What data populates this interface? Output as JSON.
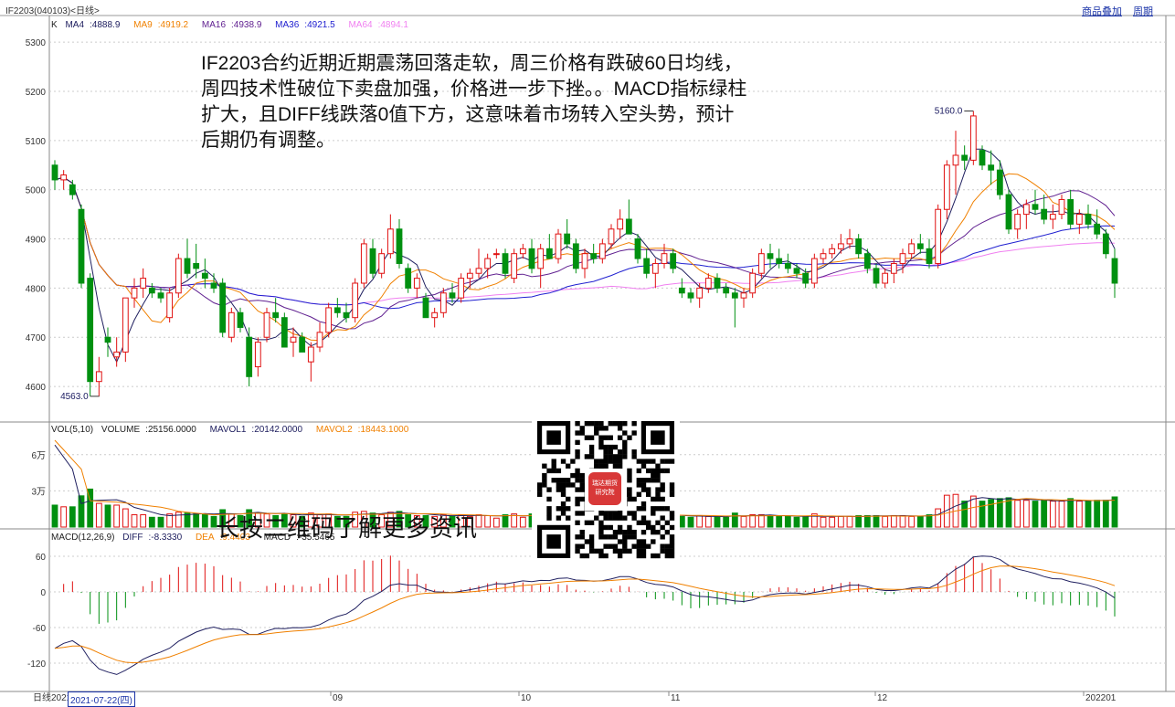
{
  "window": {
    "title": "IF2203(040103)<日线>",
    "links": [
      "商品叠加",
      "周期"
    ],
    "period_label": "日线",
    "cursor_date": "2021-07-22(四)"
  },
  "annotation": {
    "text": "IF2203合约近期近期震荡回落走软，周三价格有跌破60日均线，周四技术性破位下卖盘加强，价格进一步下挫。。MACD指标绿柱扩大，且DIFF线跌落0值下方，这意味着市场转入空头势，预计后期仍有调整。"
  },
  "qr": {
    "caption": "长按二维码了解更多资讯",
    "center_label": "瑞达期货研究院"
  },
  "colors": {
    "up": "#e01010",
    "down": "#009010",
    "ma4": "#202060",
    "ma9": "#f08000",
    "ma16": "#602090",
    "ma36": "#2020d0",
    "ma64": "#f080f0",
    "dea": "#f08000",
    "diff": "#202060"
  },
  "chart_data": [
    {
      "type": "candlestick",
      "title": "K",
      "legend": [
        {
          "name": "MA4",
          "value": "4888.9"
        },
        {
          "name": "MA9",
          "value": "4919.2"
        },
        {
          "name": "MA16",
          "value": "4938.9"
        },
        {
          "name": "MA36",
          "value": "4921.5"
        },
        {
          "name": "MA64",
          "value": "4894.1"
        }
      ],
      "y_ticks": [
        4600,
        4700,
        4800,
        4900,
        5000,
        5100,
        5200,
        5300
      ],
      "ylim": [
        4550,
        5330
      ],
      "x_labels": [
        "2021",
        "09",
        "10",
        "11",
        "12",
        "202201"
      ],
      "high_label": "5160.0",
      "low_label": "4563.0",
      "candles": [
        [
          5050,
          5060,
          5000,
          5020
        ],
        [
          5020,
          5040,
          5000,
          5030
        ],
        [
          5010,
          5020,
          4980,
          4990
        ],
        [
          4960,
          4970,
          4800,
          4810
        ],
        [
          4820,
          4830,
          4580,
          4610
        ],
        [
          4610,
          4660,
          4580,
          4630
        ],
        [
          4700,
          4720,
          4660,
          4690
        ],
        [
          4660,
          4700,
          4640,
          4670
        ],
        [
          4670,
          4780,
          4650,
          4780
        ],
        [
          4780,
          4820,
          4760,
          4800
        ],
        [
          4800,
          4840,
          4780,
          4820
        ],
        [
          4800,
          4810,
          4780,
          4790
        ],
        [
          4790,
          4800,
          4770,
          4780
        ],
        [
          4740,
          4800,
          4730,
          4790
        ],
        [
          4790,
          4870,
          4780,
          4860
        ],
        [
          4860,
          4900,
          4820,
          4830
        ],
        [
          4850,
          4890,
          4820,
          4840
        ],
        [
          4830,
          4860,
          4800,
          4820
        ],
        [
          4810,
          4830,
          4790,
          4800
        ],
        [
          4810,
          4820,
          4700,
          4710
        ],
        [
          4700,
          4760,
          4690,
          4750
        ],
        [
          4750,
          4760,
          4710,
          4720
        ],
        [
          4700,
          4720,
          4600,
          4620
        ],
        [
          4640,
          4700,
          4620,
          4690
        ],
        [
          4700,
          4760,
          4690,
          4750
        ],
        [
          4750,
          4780,
          4730,
          4740
        ],
        [
          4740,
          4750,
          4680,
          4680
        ],
        [
          4690,
          4720,
          4660,
          4700
        ],
        [
          4700,
          4710,
          4670,
          4670
        ],
        [
          4650,
          4690,
          4610,
          4680
        ],
        [
          4680,
          4730,
          4670,
          4710
        ],
        [
          4710,
          4770,
          4700,
          4760
        ],
        [
          4760,
          4780,
          4740,
          4750
        ],
        [
          4750,
          4770,
          4730,
          4740
        ],
        [
          4740,
          4820,
          4730,
          4810
        ],
        [
          4810,
          4900,
          4800,
          4890
        ],
        [
          4880,
          4900,
          4820,
          4830
        ],
        [
          4830,
          4880,
          4820,
          4870
        ],
        [
          4870,
          4950,
          4860,
          4920
        ],
        [
          4920,
          4940,
          4840,
          4850
        ],
        [
          4840,
          4850,
          4790,
          4800
        ],
        [
          4800,
          4830,
          4780,
          4820
        ],
        [
          4780,
          4790,
          4740,
          4740
        ],
        [
          4740,
          4760,
          4720,
          4750
        ],
        [
          4750,
          4800,
          4740,
          4790
        ],
        [
          4790,
          4810,
          4770,
          4780
        ],
        [
          4780,
          4830,
          4770,
          4820
        ],
        [
          4820,
          4840,
          4800,
          4830
        ],
        [
          4830,
          4880,
          4820,
          4840
        ],
        [
          4840,
          4870,
          4820,
          4860
        ],
        [
          4870,
          4880,
          4860,
          4870
        ],
        [
          4870,
          4880,
          4820,
          4830
        ],
        [
          4820,
          4880,
          4810,
          4870
        ],
        [
          4870,
          4890,
          4860,
          4880
        ],
        [
          4880,
          4900,
          4830,
          4840
        ],
        [
          4840,
          4890,
          4800,
          4880
        ],
        [
          4880,
          4910,
          4860,
          4860
        ],
        [
          4860,
          4920,
          4850,
          4910
        ],
        [
          4910,
          4940,
          4880,
          4890
        ],
        [
          4890,
          4900,
          4830,
          4840
        ],
        [
          4840,
          4880,
          4820,
          4870
        ],
        [
          4870,
          4890,
          4850,
          4860
        ],
        [
          4860,
          4900,
          4850,
          4890
        ],
        [
          4890,
          4930,
          4880,
          4920
        ],
        [
          4920,
          4960,
          4900,
          4940
        ],
        [
          4940,
          4980,
          4910,
          4910
        ],
        [
          4900,
          4910,
          4850,
          4860
        ],
        [
          4860,
          4880,
          4820,
          4830
        ],
        [
          4830,
          4860,
          4800,
          4850
        ],
        [
          4850,
          4890,
          4840,
          4870
        ],
        [
          4870,
          4880,
          4830,
          4840
        ],
        [
          4800,
          4820,
          4780,
          4790
        ],
        [
          4790,
          4800,
          4770,
          4780
        ],
        [
          4780,
          4810,
          4760,
          4800
        ],
        [
          4800,
          4830,
          4790,
          4820
        ],
        [
          4820,
          4830,
          4790,
          4800
        ],
        [
          4800,
          4810,
          4780,
          4790
        ],
        [
          4790,
          4800,
          4720,
          4780
        ],
        [
          4780,
          4800,
          4760,
          4790
        ],
        [
          4790,
          4840,
          4780,
          4830
        ],
        [
          4830,
          4880,
          4820,
          4870
        ],
        [
          4870,
          4890,
          4840,
          4860
        ],
        [
          4860,
          4880,
          4840,
          4850
        ],
        [
          4850,
          4870,
          4830,
          4840
        ],
        [
          4840,
          4850,
          4820,
          4830
        ],
        [
          4830,
          4840,
          4800,
          4810
        ],
        [
          4810,
          4870,
          4800,
          4860
        ],
        [
          4860,
          4880,
          4850,
          4870
        ],
        [
          4870,
          4890,
          4860,
          4880
        ],
        [
          4880,
          4910,
          4870,
          4890
        ],
        [
          4890,
          4920,
          4880,
          4900
        ],
        [
          4900,
          4910,
          4860,
          4870
        ],
        [
          4870,
          4880,
          4830,
          4840
        ],
        [
          4840,
          4850,
          4800,
          4810
        ],
        [
          4810,
          4840,
          4800,
          4830
        ],
        [
          4830,
          4860,
          4810,
          4850
        ],
        [
          4850,
          4880,
          4830,
          4870
        ],
        [
          4870,
          4900,
          4860,
          4890
        ],
        [
          4890,
          4910,
          4870,
          4880
        ],
        [
          4880,
          4900,
          4840,
          4850
        ],
        [
          4850,
          4970,
          4840,
          4960
        ],
        [
          4960,
          5060,
          4940,
          5050
        ],
        [
          5050,
          5120,
          4990,
          5070
        ],
        [
          5070,
          5090,
          5040,
          5060
        ],
        [
          5060,
          5160,
          5050,
          5150
        ],
        [
          5080,
          5090,
          5040,
          5050
        ],
        [
          5050,
          5080,
          5010,
          5040
        ],
        [
          5040,
          5060,
          4980,
          4990
        ],
        [
          4990,
          5000,
          4910,
          4920
        ],
        [
          4920,
          4960,
          4900,
          4950
        ],
        [
          4950,
          4980,
          4920,
          4970
        ],
        [
          4970,
          5000,
          4950,
          4960
        ],
        [
          4960,
          4990,
          4930,
          4940
        ],
        [
          4940,
          4970,
          4920,
          4950
        ],
        [
          4950,
          4990,
          4940,
          4980
        ],
        [
          4980,
          5000,
          4920,
          4930
        ],
        [
          4930,
          4960,
          4910,
          4950
        ],
        [
          4950,
          4970,
          4920,
          4930
        ],
        [
          4930,
          4960,
          4900,
          4910
        ],
        [
          4910,
          4920,
          4860,
          4870
        ],
        [
          4860,
          4880,
          4780,
          4810
        ]
      ]
    },
    {
      "type": "bar",
      "title": "VOL(5,10)",
      "legend": [
        {
          "name": "VOLUME",
          "value": "25156.0000"
        },
        {
          "name": "MAVOL1",
          "value": "20142.0000"
        },
        {
          "name": "MAVOL2",
          "value": "18443.1000"
        }
      ],
      "y_ticks": [
        "6万",
        "3万"
      ],
      "ylim": [
        0,
        75000
      ]
    },
    {
      "type": "bar",
      "title": "MACD(12,26,9)",
      "legend": [
        {
          "name": "DIFF",
          "value": "-8.3330"
        },
        {
          "name": "DEA",
          "value": "9.4403"
        },
        {
          "name": "MACD",
          "value": "-35.5465"
        }
      ],
      "y_ticks": [
        60,
        0,
        -60,
        -120
      ],
      "ylim": [
        -160,
        80
      ]
    }
  ]
}
